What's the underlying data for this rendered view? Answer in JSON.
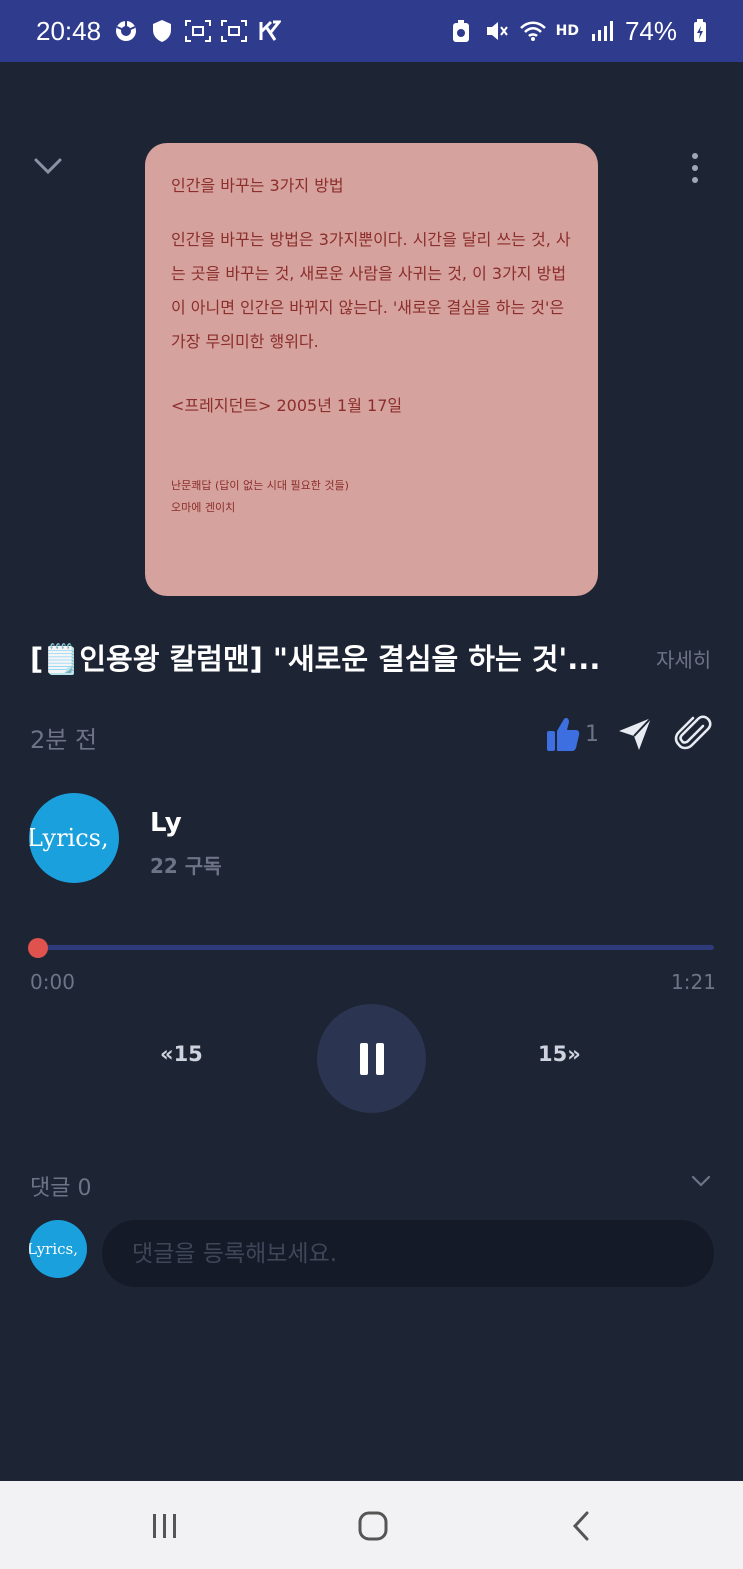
{
  "status_bar": {
    "time": "20:48",
    "battery": "74%",
    "network_label": "HD"
  },
  "cover": {
    "heading": "인간을 바꾸는 3가지 방법",
    "body": "인간을 바꾸는 방법은 3가지뿐이다. 시간을 달리 쓰는 것, 사는 곳을 바꾸는 것, 새로운 사람을 사귀는 것, 이 3가지 방법이 아니면 인간은 바뀌지 않는다. '새로운 결심을 하는 것'은 가장 무의미한 행위다.",
    "source": "<프레지던트> 2005년 1월 17일",
    "book": "난문쾌답 (답이 없는 시대 필요한 것들)",
    "author": "오마에 겐이치"
  },
  "post": {
    "title": "[🗒️인용왕 칼럼맨] \"새로운 결심을 하는 것'...",
    "detail_label": "자세히",
    "time_ago": "2분 전",
    "like_count": "1"
  },
  "channel": {
    "avatar_text": "Lyrics,",
    "name": "Ly",
    "subscribers": "22 구독"
  },
  "player": {
    "current_time": "0:00",
    "total_time": "1:21",
    "progress": 0.0,
    "rewind_label": "«15",
    "forward_label": "15»"
  },
  "comments": {
    "label": "댓글 0",
    "avatar_text": "Lyrics,",
    "placeholder": "댓글을 등록해보세요."
  },
  "colors": {
    "background": "#1d2434",
    "status_bar": "#2f3b8c",
    "cover": "#d6a29d",
    "accent_like": "#3d6fe0",
    "progress_knob": "#e0524d",
    "avatar": "#1aa0dc"
  }
}
